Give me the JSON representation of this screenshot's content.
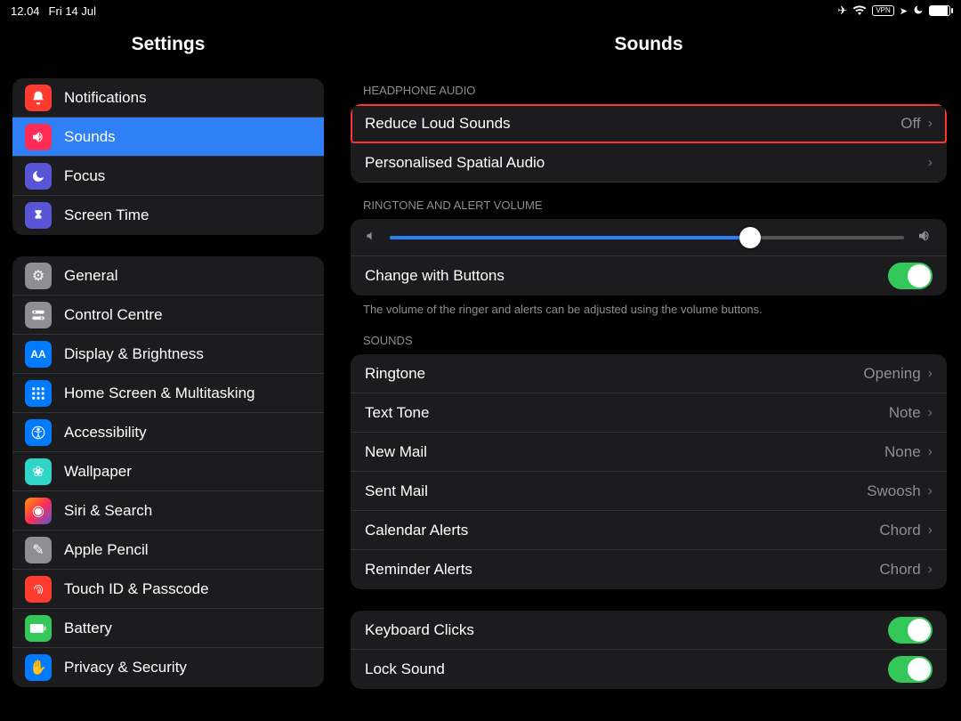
{
  "status": {
    "time": "12.04",
    "date": "Fri 14 Jul"
  },
  "sidebar": {
    "title": "Settings",
    "group1": [
      {
        "label": "Notifications"
      },
      {
        "label": "Sounds"
      },
      {
        "label": "Focus"
      },
      {
        "label": "Screen Time"
      }
    ],
    "group2": [
      {
        "label": "General"
      },
      {
        "label": "Control Centre"
      },
      {
        "label": "Display & Brightness"
      },
      {
        "label": "Home Screen & Multitasking"
      },
      {
        "label": "Accessibility"
      },
      {
        "label": "Wallpaper"
      },
      {
        "label": "Siri & Search"
      },
      {
        "label": "Apple Pencil"
      },
      {
        "label": "Touch ID & Passcode"
      },
      {
        "label": "Battery"
      },
      {
        "label": "Privacy & Security"
      }
    ]
  },
  "main": {
    "title": "Sounds",
    "sections": {
      "headphone": "Headphone Audio",
      "ringtone_vol": "Ringtone and Alert Volume",
      "sounds": "Sounds"
    },
    "headphone_rows": {
      "reduce": {
        "label": "Reduce Loud Sounds",
        "value": "Off"
      },
      "spatial": {
        "label": "Personalised Spatial Audio"
      }
    },
    "change_buttons": {
      "label": "Change with Buttons"
    },
    "volume_footnote": "The volume of the ringer and alerts can be adjusted using the volume buttons.",
    "sound_rows": [
      {
        "label": "Ringtone",
        "value": "Opening"
      },
      {
        "label": "Text Tone",
        "value": "Note"
      },
      {
        "label": "New Mail",
        "value": "None"
      },
      {
        "label": "Sent Mail",
        "value": "Swoosh"
      },
      {
        "label": "Calendar Alerts",
        "value": "Chord"
      },
      {
        "label": "Reminder Alerts",
        "value": "Chord"
      }
    ],
    "toggles": {
      "keyboard": {
        "label": "Keyboard Clicks"
      },
      "lock": {
        "label": "Lock Sound"
      }
    }
  }
}
